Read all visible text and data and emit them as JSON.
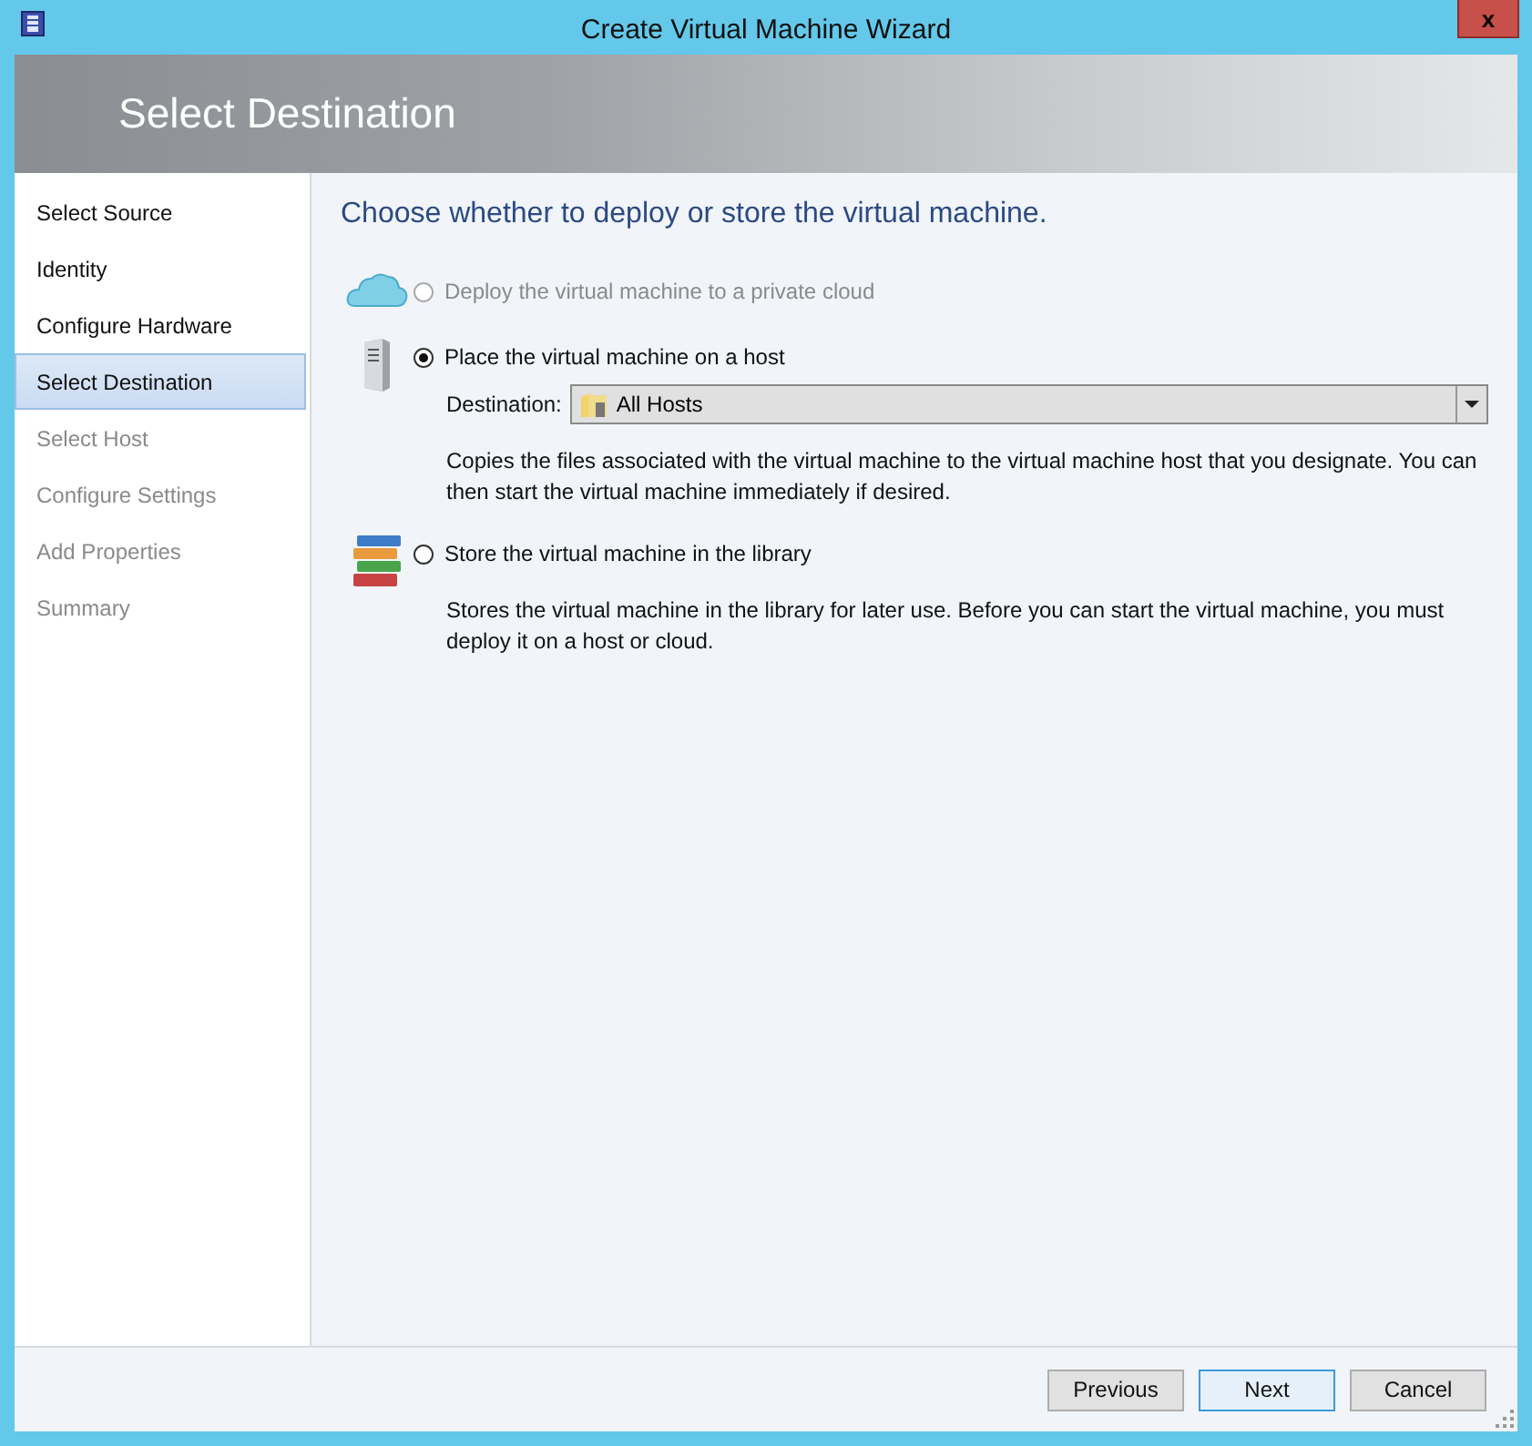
{
  "window": {
    "title": "Create Virtual Machine Wizard",
    "close": "x"
  },
  "header": {
    "title": "Select Destination"
  },
  "sidebar": {
    "items": [
      {
        "label": "Select Source",
        "selected": false,
        "disabled": false
      },
      {
        "label": "Identity",
        "selected": false,
        "disabled": false
      },
      {
        "label": "Configure Hardware",
        "selected": false,
        "disabled": false
      },
      {
        "label": "Select Destination",
        "selected": true,
        "disabled": false
      },
      {
        "label": "Select Host",
        "selected": false,
        "disabled": true
      },
      {
        "label": "Configure Settings",
        "selected": false,
        "disabled": true
      },
      {
        "label": "Add Properties",
        "selected": false,
        "disabled": true
      },
      {
        "label": "Summary",
        "selected": false,
        "disabled": true
      }
    ]
  },
  "main": {
    "heading": "Choose whether to deploy or store the virtual machine.",
    "options": [
      {
        "kind": "cloud",
        "label": "Deploy the virtual machine to a private cloud",
        "selected": false,
        "disabled": true
      },
      {
        "kind": "server",
        "label": "Place the virtual machine on a host",
        "selected": true,
        "disabled": false,
        "destination": {
          "label": "Destination:",
          "value": "All Hosts"
        },
        "description": "Copies the files associated with the virtual machine to the virtual machine host that you designate. You can then start the virtual machine immediately if desired."
      },
      {
        "kind": "books",
        "label": "Store the virtual machine in the library",
        "selected": false,
        "disabled": false,
        "description": "Stores the virtual machine in the library for later use. Before you can start the virtual machine, you must deploy it on a host or cloud."
      }
    ]
  },
  "buttons": [
    {
      "label": "Previous",
      "default": false
    },
    {
      "label": "Next",
      "default": true
    },
    {
      "label": "Cancel",
      "default": false
    }
  ]
}
